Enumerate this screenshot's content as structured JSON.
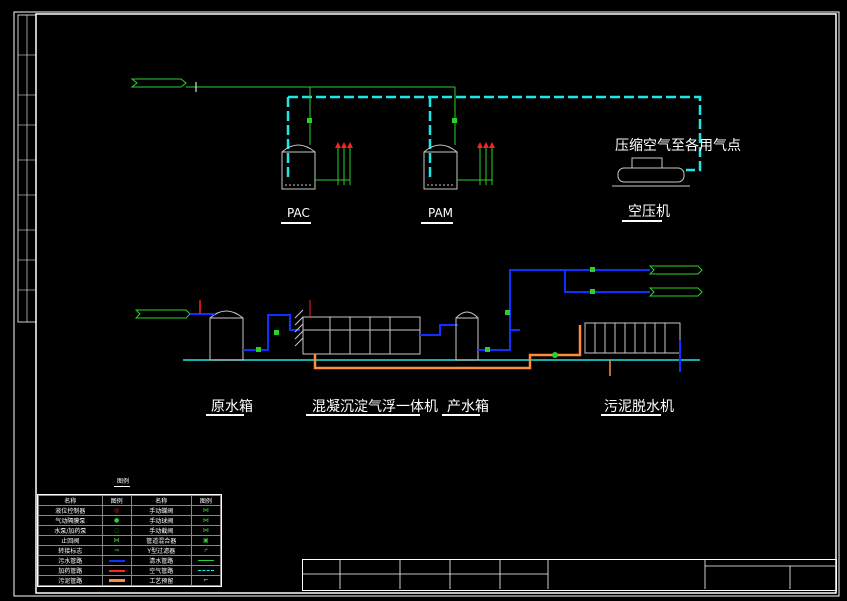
{
  "labels": {
    "pac": "PAC",
    "pam": "PAM",
    "compressor_note": "压缩空气至各用气点",
    "compressor": "空压机",
    "raw_tank": "原水箱",
    "integrated_unit": "混凝沉淀气浮一体机",
    "product_tank": "产水箱",
    "dewater": "污泥脱水机",
    "legend_title": "图例"
  },
  "legend": {
    "headers": [
      "名称",
      "图例",
      "名称",
      "图例"
    ],
    "rows": [
      [
        "液位控制器",
        "",
        "手动蝶阀",
        ""
      ],
      [
        "气动隔膜泵",
        "",
        "手动球阀",
        ""
      ],
      [
        "水泵/加药泵",
        "",
        "手动截阀",
        ""
      ],
      [
        "止回阀",
        "",
        "管道混合器",
        ""
      ],
      [
        "转接标志",
        "",
        "Y型过滤器",
        ""
      ],
      [
        "污水管路",
        "",
        "清水管路",
        ""
      ],
      [
        "加药管路",
        "",
        "空气管路",
        ""
      ],
      [
        "污泥管路",
        "",
        "工艺预留",
        ""
      ]
    ]
  },
  "colors": {
    "air": "#1ee6e6",
    "water": "#1030ff",
    "dosing": "#2bd12b",
    "sludge": "#ff8c3a",
    "red": "#ff2020",
    "equip": "#c8c8c8"
  }
}
